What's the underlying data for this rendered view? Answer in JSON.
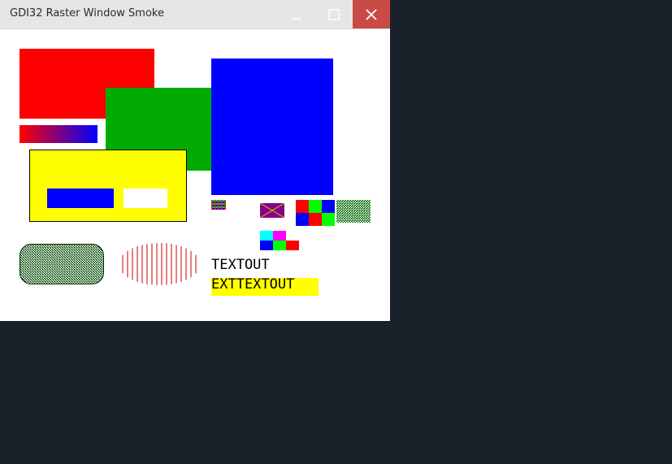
{
  "window": {
    "title": "GDI32 Raster Window Smoke",
    "buttons": {
      "minimize": "minimize",
      "maximize": "maximize",
      "close": "close"
    }
  },
  "canvas": {
    "textout": "TEXTOUT",
    "exttextout": "EXTTEXTOUT"
  },
  "colors": {
    "desktop": "#1b212b",
    "titlebar": "#e6e6e6",
    "close_button": "#c94b45",
    "red": "#ff0000",
    "green": "#00aa00",
    "blue": "#0000ff",
    "yellow": "#ffff00",
    "purple": "#880088",
    "cyan": "#00ffff",
    "magenta": "#ff00ff",
    "lime": "#00ff00",
    "hatch_green": "#006600",
    "hatch_red": "#cc0000"
  }
}
